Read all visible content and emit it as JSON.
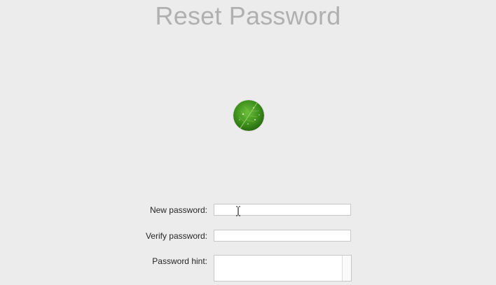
{
  "window": {
    "title": "Reset Password"
  },
  "avatar": {
    "icon": "leaf-avatar-icon"
  },
  "form": {
    "new_password": {
      "label": "New password:",
      "value": ""
    },
    "verify_password": {
      "label": "Verify password:",
      "value": ""
    },
    "password_hint": {
      "label": "Password hint:",
      "value": ""
    }
  },
  "colors": {
    "background": "#ececec",
    "title": "#b0b0b0",
    "leaf_green": "#3e8f1c"
  }
}
